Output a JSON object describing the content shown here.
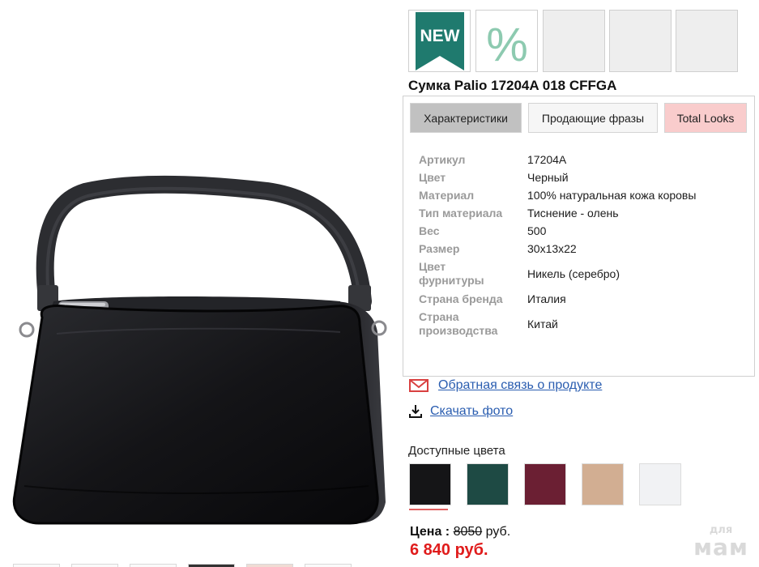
{
  "product": {
    "title": "Сумка Palio 17204A 018 CFFGA",
    "image_alt": "Черная кожаная сумка"
  },
  "badges": [
    {
      "label": "NEW",
      "color": "#1f7a6e"
    },
    {
      "label": "%",
      "color": "#8dcab0"
    }
  ],
  "tabs": [
    {
      "label": "Характеристики",
      "active": true
    },
    {
      "label": "Продающие фразы",
      "active": false
    },
    {
      "label": "Total Looks",
      "active": false
    }
  ],
  "specs": [
    {
      "key": "Артикул",
      "value": "17204A"
    },
    {
      "key": "Цвет",
      "value": "Черный"
    },
    {
      "key": "Материал",
      "value": "100% натуральная кожа коровы"
    },
    {
      "key": "Тип материала",
      "value": "Тиснение - олень"
    },
    {
      "key": "Вес",
      "value": "500"
    },
    {
      "key": "Размер",
      "value": "30x13x22"
    },
    {
      "key": "Цвет фурнитуры",
      "value": "Никель (серебро)"
    },
    {
      "key": "Страна бренда",
      "value": "Италия"
    },
    {
      "key": "Страна производства",
      "value": "Китай"
    }
  ],
  "links": {
    "feedback": {
      "label": "Обратная связь о продукте",
      "icon": "mail-icon"
    },
    "download": {
      "label": "Скачать фото",
      "icon": "download-icon"
    }
  },
  "colors": {
    "title": "Доступные цвета",
    "swatches": [
      "#151517",
      "#1e4a44",
      "#6b1f33",
      "#d2ae92",
      "#f1f2f4"
    ],
    "selected": 0
  },
  "price": {
    "label": "Цена :",
    "old": "8050",
    "currency": "руб.",
    "new": "6 840 руб."
  },
  "watermark": {
    "top": "для",
    "bottom": "мам"
  },
  "accent": {
    "link": "#2a5db0",
    "price": "#e01b1b",
    "mail": "#d94040"
  }
}
